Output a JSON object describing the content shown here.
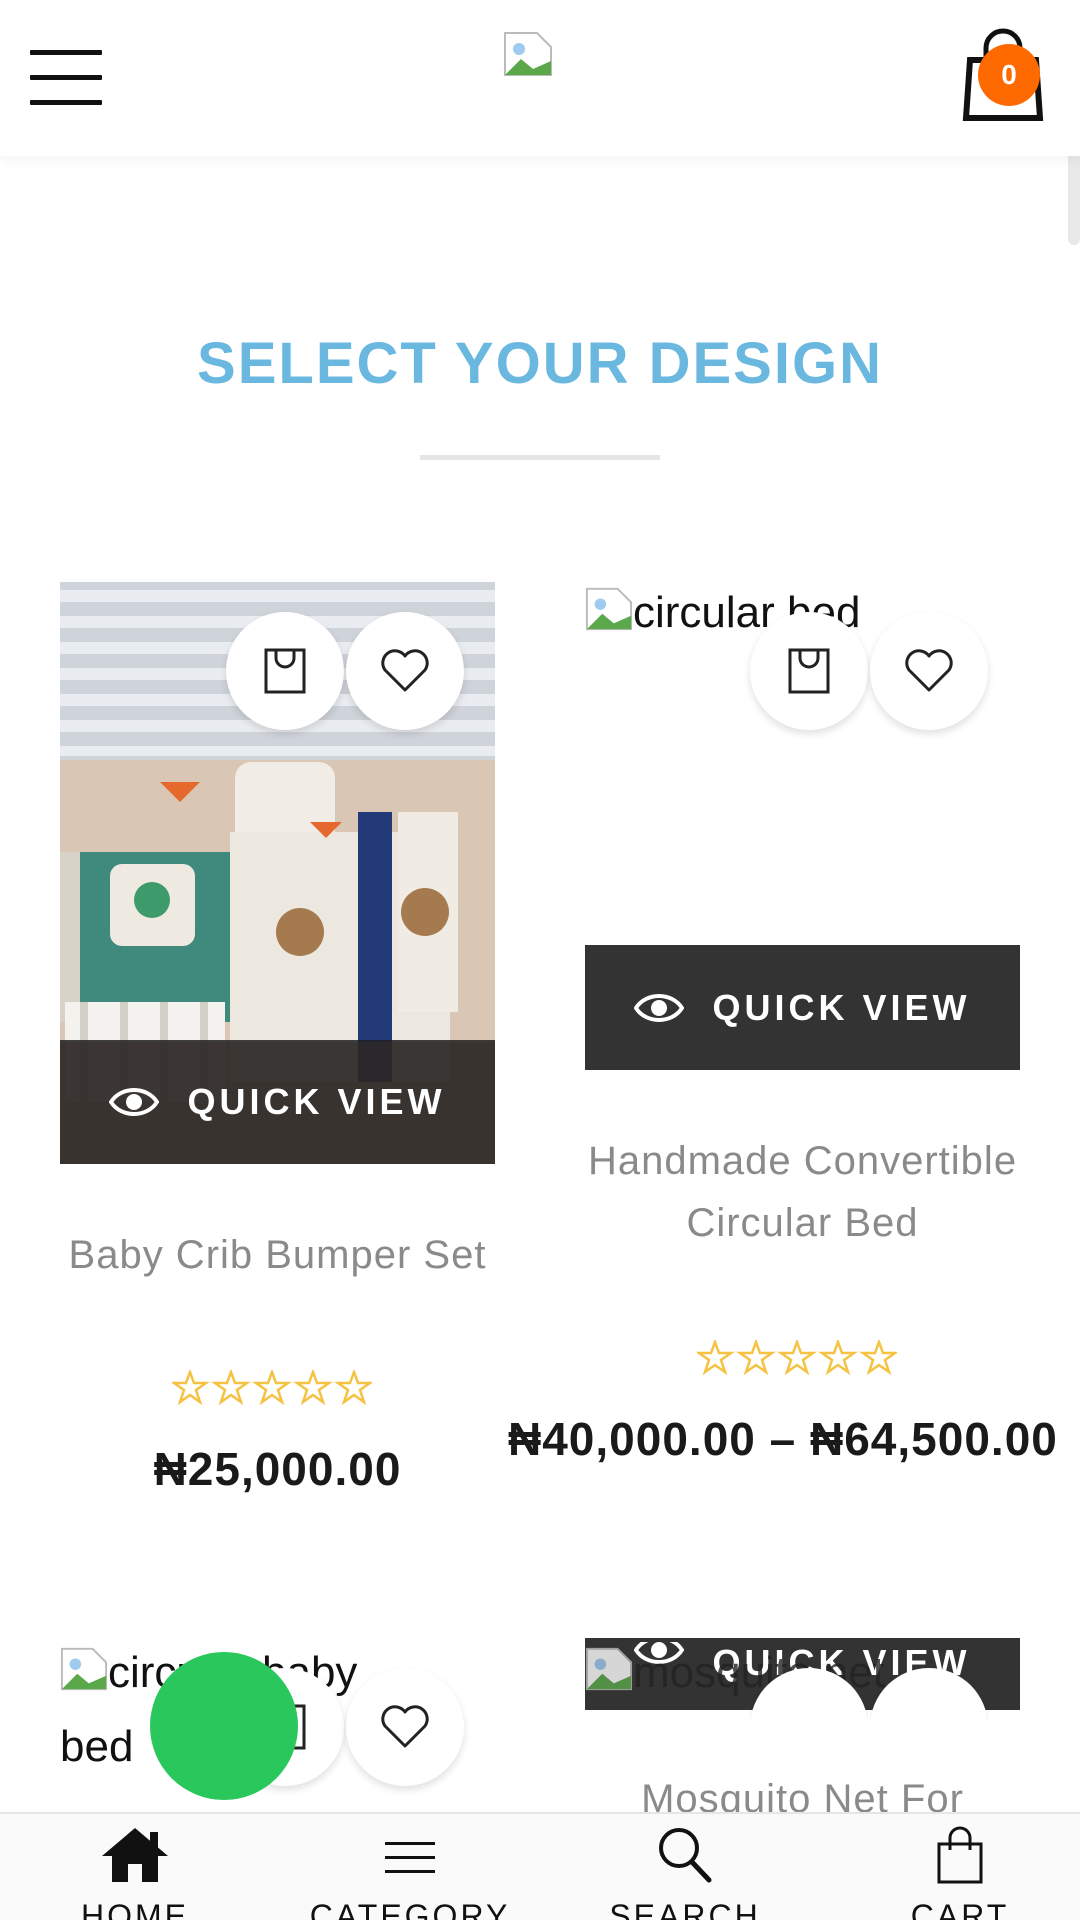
{
  "header": {
    "logo_alt": "",
    "cart_count": "0"
  },
  "section": {
    "title": "SELECT YOUR DESIGN"
  },
  "products": [
    {
      "name": "Baby Crib Bumper Set",
      "price": "₦25,000.00",
      "rating": 0,
      "quick_view_label": "QUICK VIEW"
    },
    {
      "name": "Handmade Convertible Circular Bed",
      "image_alt": "circular bed",
      "price": "₦40,000.00 – ₦64,500.00",
      "rating": 0,
      "quick_view_label": "QUICK VIEW"
    },
    {
      "image_alt": "circular baby bed"
    },
    {
      "name": "Mosquito Net For",
      "image_alt": "mosquito net",
      "quick_view_label": "QUICK VIEW"
    }
  ],
  "bottom_nav": [
    {
      "label": "HOME",
      "icon": "home-icon"
    },
    {
      "label": "CATEGORY",
      "icon": "menu-icon"
    },
    {
      "label": "SEARCH",
      "icon": "search-icon"
    },
    {
      "label": "CART",
      "icon": "bag-icon"
    }
  ],
  "colors": {
    "accent": "#6ab8e0",
    "badge": "#ff6a00",
    "star": "#f5c242",
    "whatsapp_fab": "#2ac75c",
    "quick_view_bg": "#333333"
  }
}
